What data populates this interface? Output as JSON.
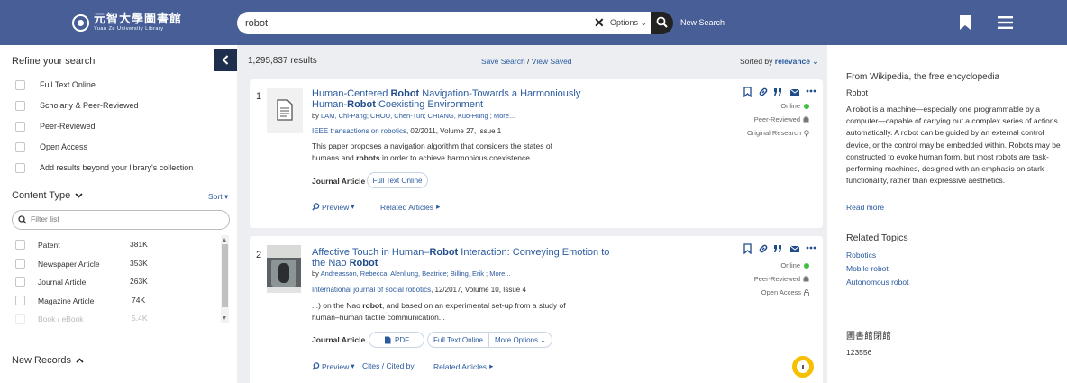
{
  "header": {
    "logo_cn": "元智大學圖書館",
    "logo_en": "Yuan Ze University Library",
    "search_value": "robot",
    "options_label": "Options",
    "new_search_label": "New Search"
  },
  "sidebar": {
    "refine_title": "Refine your search",
    "filters": [
      "Full Text Online",
      "Scholarly & Peer-Reviewed",
      "Peer-Reviewed",
      "Open Access",
      "Add results beyond your library's collection"
    ],
    "content_type_title": "Content Type",
    "sort_label": "Sort",
    "filter_placeholder": "Filter list",
    "content_types": [
      {
        "label": "Patent",
        "count": "381K"
      },
      {
        "label": "Newspaper Article",
        "count": "353K"
      },
      {
        "label": "Journal Article",
        "count": "263K"
      },
      {
        "label": "Magazine Article",
        "count": "74K"
      },
      {
        "label": "Book / eBook",
        "count": "5.4K"
      }
    ],
    "new_records_title": "New Records"
  },
  "main": {
    "results_count": "1,295,837 results",
    "save_search": "Save Search",
    "separator": "/",
    "view_saved": "View Saved",
    "sorted_by": "Sorted by",
    "sort_value": "relevance",
    "results": [
      {
        "index": "1",
        "title_parts": [
          "Human-Centered ",
          "Robot",
          " Navigation-Towards a Harmoniously Human-",
          "Robot",
          " Coexisting Environment"
        ],
        "authors_prefix": "by ",
        "authors": "LAM, Chi-Pang; CHOU, Chen-Tun; CHIANG, Kuo-Hung ; More...",
        "source_name": "IEEE transactions on robotics",
        "source_detail": ", 02/2011, Volume 27, Issue 1",
        "snippet_parts": [
          "This paper proposes a navigation algorithm that considers the states of humans and ",
          "robots",
          " in order to achieve harmonious coexistence..."
        ],
        "doc_type": "Journal Article",
        "full_text": "Full Text Online",
        "preview": "Preview",
        "related": "Related Articles",
        "status": [
          "Online",
          "Peer-Reviewed",
          "Original Research"
        ]
      },
      {
        "index": "2",
        "title_parts": [
          "Affective Touch in Human–",
          "Robot",
          " Interaction: Conveying Emotion to the Nao ",
          "Robot",
          ""
        ],
        "authors_prefix": "by ",
        "authors": "Andreasson, Rebecca; Alenljung, Beatrice; Billing, Erik ; More...",
        "source_name": "International journal of social robotics",
        "source_detail": ", 12/2017, Volume 10, Issue 4",
        "snippet_parts": [
          "...) on the Nao ",
          "robot",
          ", and based on an experimental set-up from a study of human–human tactile communication..."
        ],
        "doc_type": "Journal Article",
        "pdf": "PDF",
        "full_text": "Full Text Online",
        "more_options": "More Options",
        "preview": "Preview",
        "cites": "Cites / Cited by",
        "related": "Related Articles",
        "status": [
          "Online",
          "Peer-Reviewed",
          "Open Access"
        ]
      }
    ]
  },
  "wiki": {
    "source": "From Wikipedia, the free encyclopedia",
    "term": "Robot",
    "body": "A robot is a machine—especially one programmable by a computer—capable of carrying out a complex series of actions automatically. A robot can be guided by an external control device, or the control may be embedded within. Robots may be constructed to evoke human form, but most robots are task-performing machines, designed with an emphasis on stark functionality, rather than expressive aesthetics.",
    "read_more": "Read more",
    "related_title": "Related Topics",
    "related_topics": [
      "Robotics",
      "Mobile robot",
      "Autonomous robot"
    ],
    "library_name": "圖書館閉館",
    "library_number": "123556"
  },
  "colors": {
    "header_bg": "#475f96",
    "link": "#2a5a9e",
    "online_dot": "#3fbf3f",
    "fab": "#f5c000"
  }
}
